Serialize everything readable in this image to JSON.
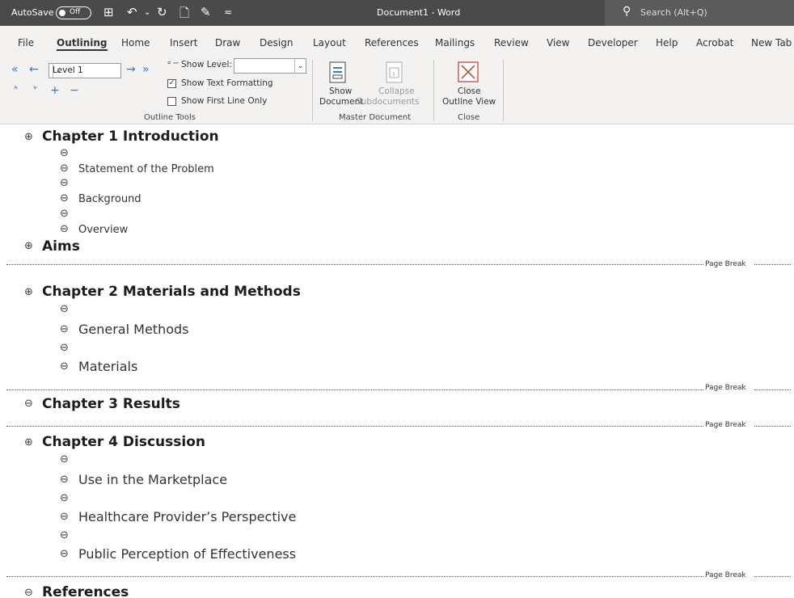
{
  "titlebar": {
    "autosave_label": "AutoSave",
    "autosave_state": "Off",
    "document_title": "Document1  -  Word",
    "search_placeholder": "Search (Alt+Q)"
  },
  "tabs": [
    "File",
    "Outlining",
    "Home",
    "Insert",
    "Draw",
    "Design",
    "Layout",
    "References",
    "Mailings",
    "Review",
    "View",
    "Developer",
    "Help",
    "Acrobat",
    "New Tab"
  ],
  "active_tab": "Outlining",
  "ribbon": {
    "level_value": "Level 1",
    "show_level_label": "Show Level:",
    "show_text_formatting": "Show Text Formatting",
    "show_first_line_only": "Show First Line Only",
    "outline_tools_label": "Outline Tools",
    "show_document_1": "Show",
    "show_document_2": "Document",
    "collapse_1": "Collapse",
    "collapse_2": "Subdocuments",
    "master_document_label": "Master Document",
    "close_1": "Close",
    "close_2": "Outline View",
    "close_group_label": "Close"
  },
  "outline": {
    "ch1": "Chapter 1 Introduction",
    "ch1_items": [
      "Statement of the Problem",
      "Background",
      "Overview"
    ],
    "aims": "Aims",
    "ch2": "Chapter 2 Materials and Methods",
    "ch2_items": [
      "General Methods",
      "Materials"
    ],
    "ch3": "Chapter 3 Results",
    "ch4": "Chapter 4 Discussion",
    "ch4_items": [
      "Use in the Marketplace",
      "Healthcare Provider’s Perspective",
      "Public Perception of Effectiveness"
    ],
    "references": "References",
    "page_break": "Page Break"
  }
}
